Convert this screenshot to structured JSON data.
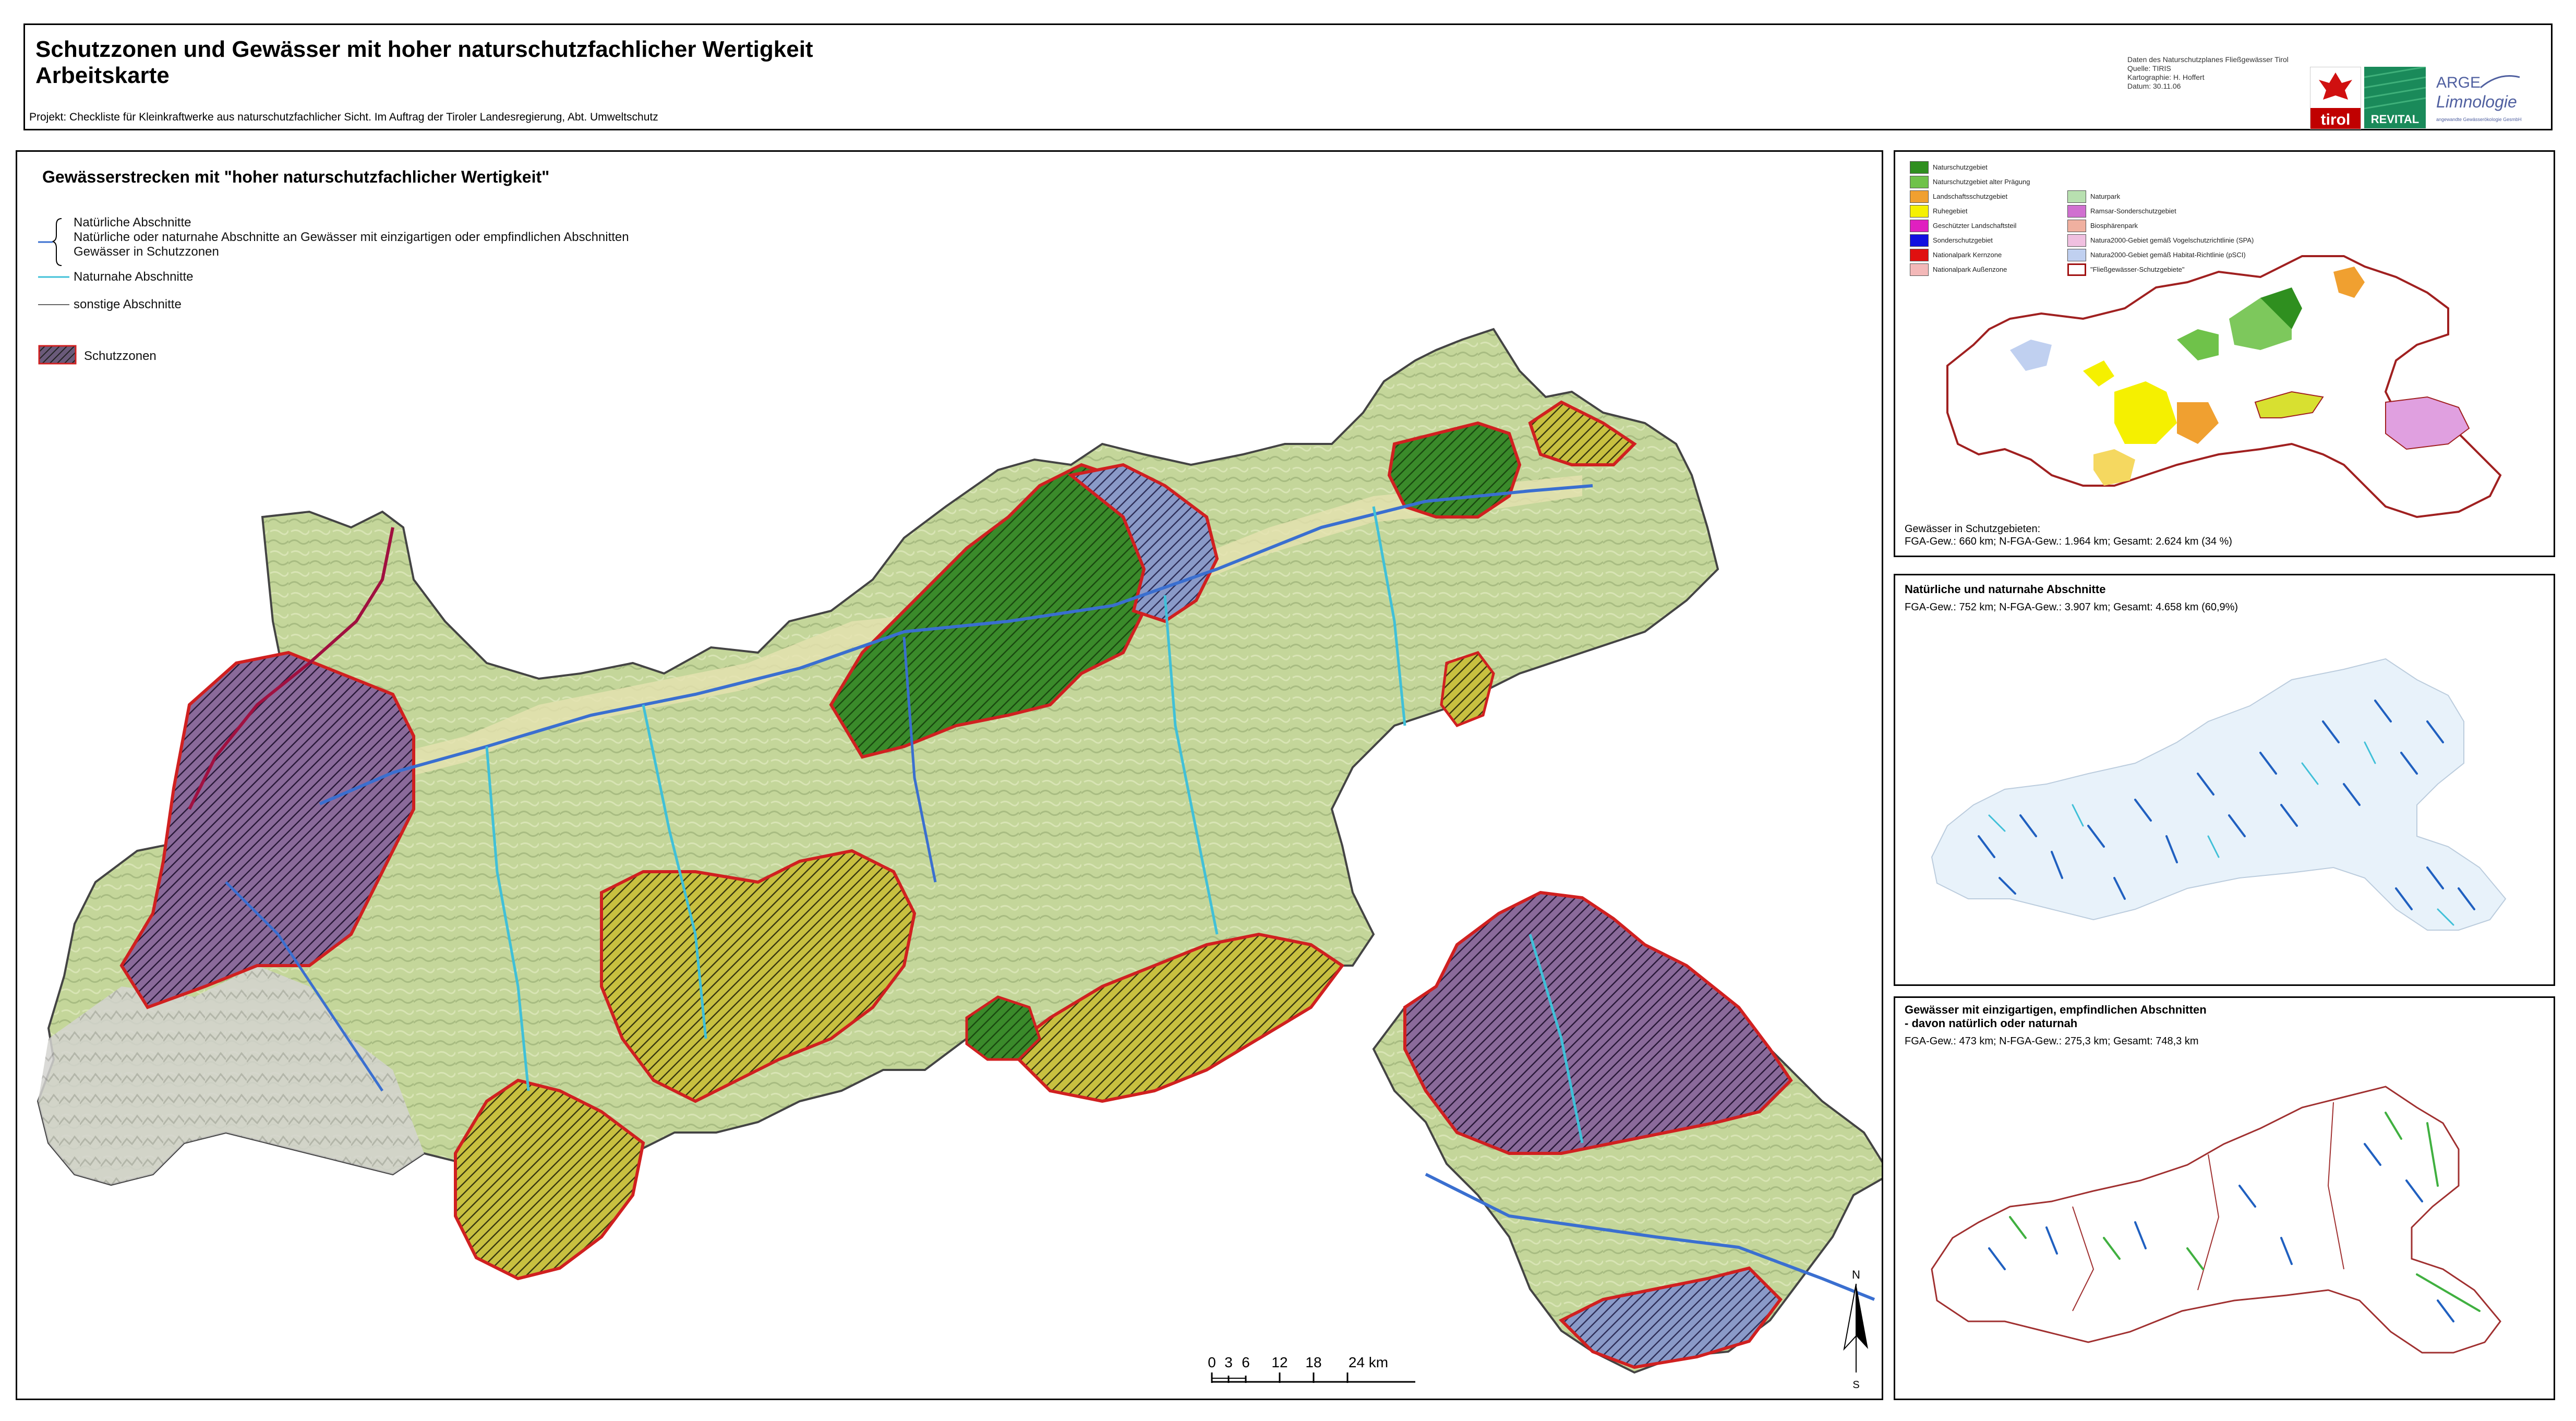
{
  "header": {
    "title_line1": "Schutzzonen und Gewässer mit hoher naturschutzfachlicher Wertigkeit",
    "title_line2": "Arbeitskarte",
    "project": "Projekt: Checkliste für Kleinkraftwerke aus naturschutzfachlicher Sicht.  Im Auftrag der Tiroler Landesregierung, Abt. Umweltschutz",
    "credits": [
      "Daten des Naturschutzplanes Fließgewässer Tirol",
      "Quelle: TIRIS",
      "Kartographie: H. Hoffert",
      "Datum: 30.11.06"
    ],
    "logos": {
      "tirol": "tirol",
      "revital": "REVITAL",
      "arge_line1": "ARGE",
      "arge_line2": "Limnologie",
      "arge_sub": "angewandte Gewässerökologie GesmbH"
    }
  },
  "main": {
    "title": "Gewässerstrecken mit \"hoher naturschutzfachlicher Wertigkeit\"",
    "legend": {
      "group_lines": [
        "Natürliche Abschnitte",
        "Natürliche oder naturnahe Abschnitte an Gewässer mit einzigartigen oder empfindlichen Abschnitten",
        "Gewässer in Schutzzonen"
      ],
      "naturnah": "Naturnahe Abschnitte",
      "sonstige": "sonstige Abschnitte",
      "schutzzonen": "Schutzzonen"
    },
    "scale": {
      "ticks": [
        "0",
        "3",
        "6",
        "12",
        "18",
        "24 km"
      ]
    },
    "north": {
      "n": "N",
      "s": "S"
    }
  },
  "panel_schutzgebiete": {
    "legend_left": [
      {
        "label": "Naturschutzgebiet",
        "color": "#2f8f1f"
      },
      {
        "label": "Naturschutzgebiet alter Prägung",
        "color": "#6fc24a"
      },
      {
        "label": "Landschaftsschutzgebiet",
        "color": "#f0a030"
      },
      {
        "label": "Ruhegebiet",
        "color": "#f5f000"
      },
      {
        "label": "Geschützter Landschaftsteil",
        "color": "#e020c0"
      },
      {
        "label": "Sonderschutzgebiet",
        "color": "#1010e0"
      },
      {
        "label": "Nationalpark Kernzone",
        "color": "#e01010"
      },
      {
        "label": "Nationalpark Außenzone",
        "color": "#f3b8b8"
      }
    ],
    "legend_right": [
      {
        "label": "Naturpark",
        "color": "#b8e0b0"
      },
      {
        "label": "Ramsar-Sonderschutzgebiet",
        "color": "#d070d0"
      },
      {
        "label": "Biosphärenpark",
        "color": "#f0b0a0"
      },
      {
        "label": "Natura2000-Gebiet gemäß Vogelschutzrichtlinie (SPA)",
        "color": "#f0c0e0"
      },
      {
        "label": "Natura2000-Gebiet gemäß Habitat-Richtlinie (pSCI)",
        "color": "#c0d0f0"
      },
      {
        "label": "\"Fließgewässer-Schutzgebiete\"",
        "color": "#ffffff"
      }
    ],
    "stats_title": "Gewässer in Schutzgebieten:",
    "stats": "FGA-Gew.: 660 km; N-FGA-Gew.: 1.964 km; Gesamt: 2.624 km (34 %)"
  },
  "panel_natuerlich": {
    "title": "Natürliche und naturnahe Abschnitte",
    "stats": "FGA-Gew.: 752 km; N-FGA-Gew.: 3.907 km; Gesamt: 4.658 km (60,9%)"
  },
  "panel_einzigartig": {
    "title_line1": "Gewässer mit einzigartigen, empfindlichen Abschnitten",
    "title_line2": "- davon natürlich oder naturnah",
    "stats": "FGA-Gew.: 473 km; N-FGA-Gew.: 275,3 km; Gesamt: 748,3 km"
  },
  "colors": {
    "terrain": "#c8d8a0",
    "valley": "#e8e4b0",
    "mountain": "#c8c8c8",
    "river_blue": "#3a6fd0",
    "river_cyan": "#40c0d8",
    "border_red": "#cc2020",
    "nsg_green": "#2f7a1e",
    "lsg_yellow": "#d8c020",
    "nat_purple": "#5a3a6a"
  }
}
